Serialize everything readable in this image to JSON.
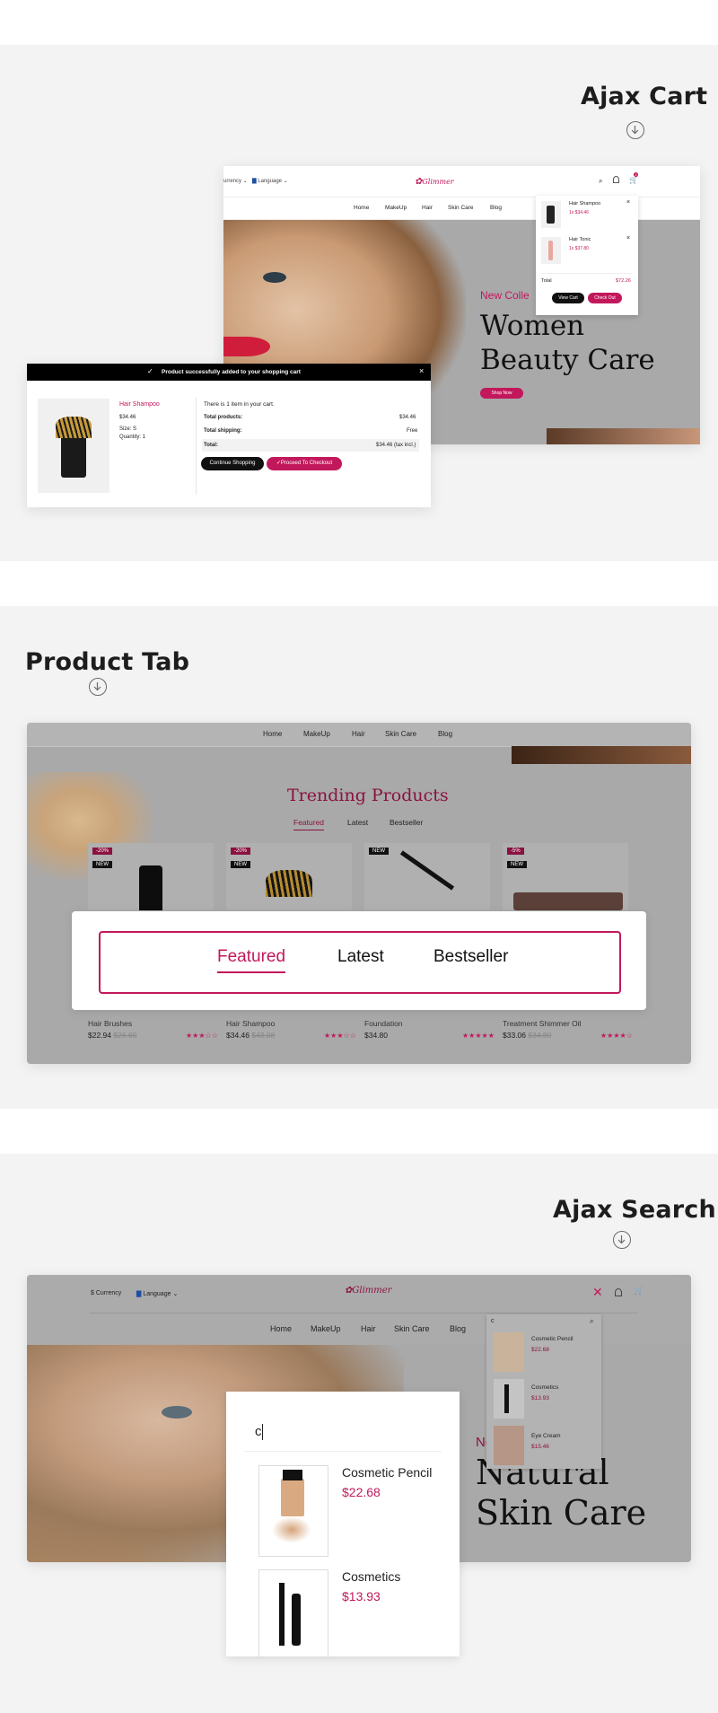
{
  "sections": {
    "ajax_cart": {
      "title": "Ajax Cart"
    },
    "product_tab": {
      "title": "Product Tab"
    },
    "ajax_search": {
      "title": "Ajax Search"
    }
  },
  "store": {
    "logo": "Glimmer",
    "currency": "$ Currency",
    "currency_cut": "urrency",
    "language": "Language",
    "nav": [
      "Home",
      "MakeUp",
      "Hair",
      "Skin Care",
      "Blog"
    ],
    "cart_count": "2"
  },
  "cart_dropdown": {
    "items": [
      {
        "name": "Hair Shampoo",
        "price": "1x $34.46"
      },
      {
        "name": "Hair Tonic",
        "price": "1x $37.80"
      }
    ],
    "total_label": "Total",
    "total_value": "$72.26",
    "view_cart": "View Cart",
    "checkout": "Check Out"
  },
  "hero1": {
    "tagline": "New Colle",
    "title_line1": "Women",
    "title_line2": "Beauty Care",
    "button": "Shop Now"
  },
  "modal": {
    "banner": "Product successfully added to your shopping cart",
    "product_name": "Hair Shampoo",
    "product_price": "$34.46",
    "size": "Size: S",
    "quantity": "Quantity: 1",
    "summary": "There is 1 item in your cart.",
    "total_products_label": "Total products:",
    "total_products_value": "$34.46",
    "total_shipping_label": "Total shipping:",
    "total_shipping_value": "Free",
    "total_label": "Total:",
    "total_value": "$34.46 (tax incl.)",
    "continue": "Continue Shopping",
    "checkout": "Proceed To Checkout"
  },
  "trending": {
    "title": "Trending Products",
    "tabs": [
      "Featured",
      "Latest",
      "Bestseller"
    ],
    "zoom_tabs": [
      "Featured",
      "Latest",
      "Bestseller"
    ],
    "products": [
      {
        "name": "Hair Brushes",
        "price": "$22.94",
        "old_price": "$26.60",
        "discount": "-20%",
        "new": "NEW",
        "stars": "★★★☆☆"
      },
      {
        "name": "Hair Shampoo",
        "price": "$34.46",
        "old_price": "$43.08",
        "discount": "-20%",
        "new": "NEW",
        "stars": "★★★☆☆"
      },
      {
        "name": "Foundation",
        "price": "$34.80",
        "old_price": "",
        "discount": "",
        "new": "NEW",
        "stars": "★★★★★"
      },
      {
        "name": "Treatment Shimmer Oil",
        "price": "$33.06",
        "old_price": "$34.80",
        "discount": "-5%",
        "new": "NEW",
        "stars": "★★★★☆"
      }
    ]
  },
  "search": {
    "query": "c",
    "dropdown_items": [
      {
        "name": "Cosmetic Pencil",
        "price": "$22.68"
      },
      {
        "name": "Cosmetics",
        "price": "$13.93"
      },
      {
        "name": "Eye Cream",
        "price": "$15.46"
      }
    ],
    "zoom_items": [
      {
        "name": "Cosmetic Pencil",
        "price": "$22.68"
      },
      {
        "name": "Cosmetics",
        "price": "$13.93"
      }
    ]
  },
  "hero2": {
    "tagline": "Ne",
    "title_line1": "Natural",
    "title_line2": "Skin Care"
  },
  "colors": {
    "accent": "#c2185b",
    "band": "#f3f3f3",
    "dark": "#111111"
  }
}
